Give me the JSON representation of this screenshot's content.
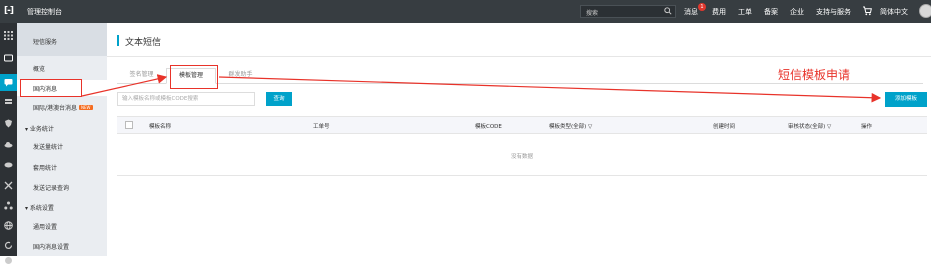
{
  "topbar": {
    "logo": "[-]",
    "console_title": "管理控制台",
    "search_placeholder": "搜索",
    "nav": {
      "messages": "消息",
      "messages_badge": "1",
      "billing": "费用",
      "tickets": "工单",
      "icp": "备案",
      "enterprise": "企业",
      "support": "支持与服务",
      "language": "简体中文"
    }
  },
  "sidebar": {
    "header": "短信服务",
    "items": {
      "overview": "概览",
      "domestic": "国内消息",
      "international": "国际/港澳台消息",
      "new_tag": "NEW",
      "stats_group": "业务统计",
      "send_stats": "发送量统计",
      "usage_stats": "套用统计",
      "send_records": "发送记录查询",
      "settings_group": "系统设置",
      "general_settings": "通用设置",
      "domestic_settings": "国内消息设置"
    }
  },
  "main": {
    "page_title": "文本短信",
    "tabs": [
      "签名管理",
      "模板管理",
      "群发助手"
    ],
    "search_placeholder": "输入模板名称或模板CODE搜索",
    "query_button": "查询",
    "add_button": "添加模板",
    "table": {
      "columns": [
        "模板名称",
        "工单号",
        "模板CODE",
        "模板类型(全部)",
        "创建时间",
        "审核状态(全部)",
        "操作"
      ],
      "empty": "没有数据"
    }
  },
  "annotation": {
    "text": "短信模板申请",
    "color": "#e8332a"
  },
  "colors": {
    "accent": "#00a2ca",
    "topbar": "#373d41",
    "rail": "#2d3135",
    "sidebar": "#eaedf1"
  }
}
